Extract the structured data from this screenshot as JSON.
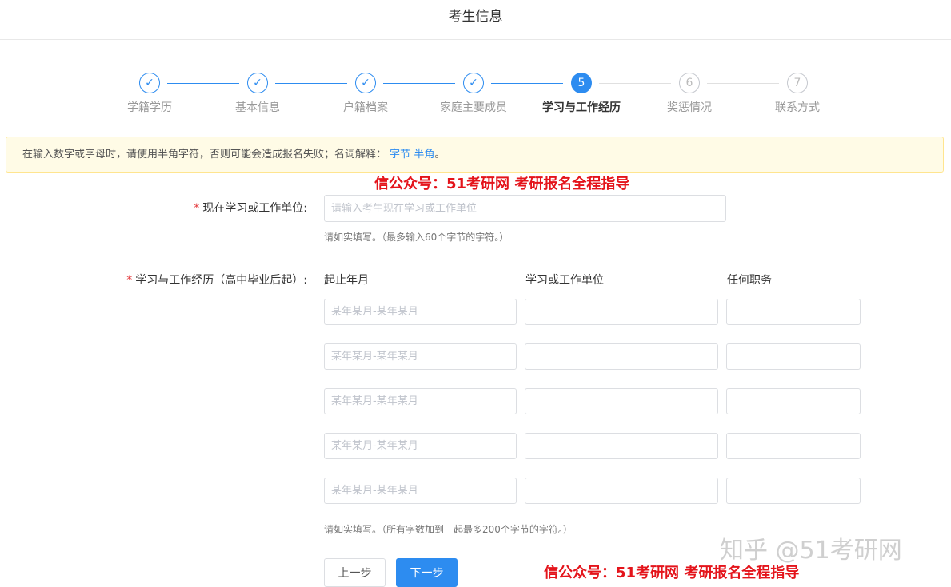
{
  "header": {
    "title": "考生信息"
  },
  "steps": [
    {
      "number": "1",
      "label": "学籍学历",
      "state": "done"
    },
    {
      "number": "2",
      "label": "基本信息",
      "state": "done"
    },
    {
      "number": "3",
      "label": "户籍档案",
      "state": "done"
    },
    {
      "number": "4",
      "label": "家庭主要成员",
      "state": "done"
    },
    {
      "number": "5",
      "label": "学习与工作经历",
      "state": "active"
    },
    {
      "number": "6",
      "label": "奖惩情况",
      "state": "todo"
    },
    {
      "number": "7",
      "label": "联系方式",
      "state": "todo"
    }
  ],
  "icons": {
    "done_step": "check-icon"
  },
  "notice": {
    "text": "在输入数字或字母时，请使用半角字符，否则可能会造成报名失败；名词解释：",
    "link1": "字节",
    "link2": "半角",
    "end": "。"
  },
  "watermarks": {
    "top": "信公众号：51考研网  考研报名全程指导",
    "bottom": "信公众号：51考研网  考研报名全程指导",
    "zhihu": "知乎 @51考研网"
  },
  "current_unit": {
    "required_mark": "*",
    "label": "现在学习或工作单位:",
    "placeholder": "请输入考生现在学习或工作单位",
    "value": "",
    "hint": "请如实填写。（最多输入60个字节的字符。）"
  },
  "history": {
    "required_mark": "*",
    "label": "学习与工作经历（高中毕业后起）:",
    "columns": [
      "起止年月",
      "学习或工作单位",
      "任何职务"
    ],
    "date_placeholder": "某年某月-某年某月",
    "rows": [
      {
        "period": "",
        "unit": "",
        "position": ""
      },
      {
        "period": "",
        "unit": "",
        "position": ""
      },
      {
        "period": "",
        "unit": "",
        "position": ""
      },
      {
        "period": "",
        "unit": "",
        "position": ""
      },
      {
        "period": "",
        "unit": "",
        "position": ""
      }
    ],
    "hint": "请如实填写。（所有字数加到一起最多200个字节的字符。）"
  },
  "buttons": {
    "prev": "上一步",
    "next": "下一步"
  },
  "colors": {
    "accent": "#2d8cf0",
    "required": "#e4393c",
    "watermark": "#e4141b",
    "notice_bg": "#fffbe6"
  }
}
